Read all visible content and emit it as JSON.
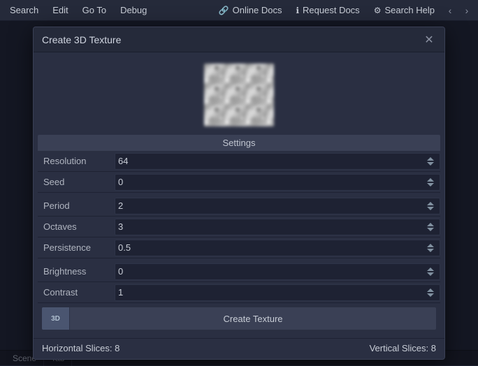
{
  "menubar": {
    "items": [
      {
        "label": "Search",
        "id": "search"
      },
      {
        "label": "Edit",
        "id": "edit"
      },
      {
        "label": "Go To",
        "id": "goto"
      },
      {
        "label": "Debug",
        "id": "debug"
      }
    ],
    "right_items": [
      {
        "label": "Online Docs",
        "icon": "🔗",
        "id": "online-docs"
      },
      {
        "label": "Request Docs",
        "icon": "ℹ",
        "id": "request-docs"
      },
      {
        "label": "Search Help",
        "icon": "⚙",
        "id": "search-help"
      }
    ],
    "nav_prev": "‹",
    "nav_next": "›"
  },
  "dialog": {
    "title": "Create 3D Texture",
    "close_icon": "✕",
    "settings_label": "Settings",
    "fields": [
      {
        "id": "resolution",
        "label": "Resolution",
        "value": "64",
        "gap": false
      },
      {
        "id": "seed",
        "label": "Seed",
        "value": "0",
        "gap": false
      },
      {
        "id": "period",
        "label": "Period",
        "value": "2",
        "gap": true
      },
      {
        "id": "octaves",
        "label": "Octaves",
        "value": "3",
        "gap": false
      },
      {
        "id": "persistence",
        "label": "Persistence",
        "value": "0.5",
        "gap": false
      },
      {
        "id": "brightness",
        "label": "Brightness",
        "value": "0",
        "gap": true
      },
      {
        "id": "contrast",
        "label": "Contrast",
        "value": "1",
        "gap": false
      }
    ],
    "create_button": {
      "label": "Create Texture",
      "icon_label": "3D"
    },
    "footer": {
      "horizontal_slices_label": "Horizontal Slices:",
      "horizontal_slices_value": "8",
      "vertical_slices_label": "Vertical Slices:",
      "vertical_slices_value": "8"
    }
  },
  "bottom_bar": {
    "tabs": [
      {
        "label": "Scene"
      },
      {
        "label": "Tab"
      }
    ]
  }
}
